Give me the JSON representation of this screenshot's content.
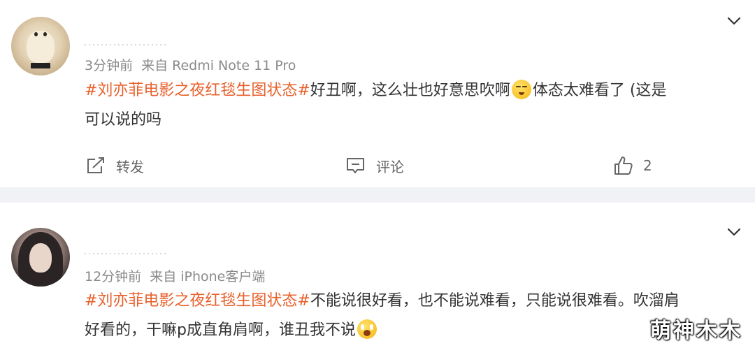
{
  "posts": [
    {
      "time": "3分钟前",
      "source": "来自 Redmi Note 11 Pro",
      "topic": "#刘亦菲电影之夜红毯生图状态#",
      "text_line1": "好丑啊，这么壮也好意思吹啊",
      "emoji": "squint-face-emoji",
      "text_line1_end": "体态太难看了 (这是",
      "text_line2": "可以说的吗",
      "actions": {
        "repost_label": "转发",
        "comment_label": "评论",
        "like_count": "2"
      }
    },
    {
      "time": "12分钟前",
      "source": "来自 iPhone客户端",
      "topic": "#刘亦菲电影之夜红毯生图状态#",
      "text_line1": "不能说很好看，也不能说难看，只能说很难看。吹溜肩",
      "text_line2": "好看的，干嘛p成直角肩啊，谁丑我不说",
      "emoji": "crying-face-emoji"
    }
  ],
  "watermark": "萌神木木",
  "colors": {
    "topic": "#e8602c",
    "meta": "#8a8a8a",
    "divider": "#f1f2f5"
  }
}
